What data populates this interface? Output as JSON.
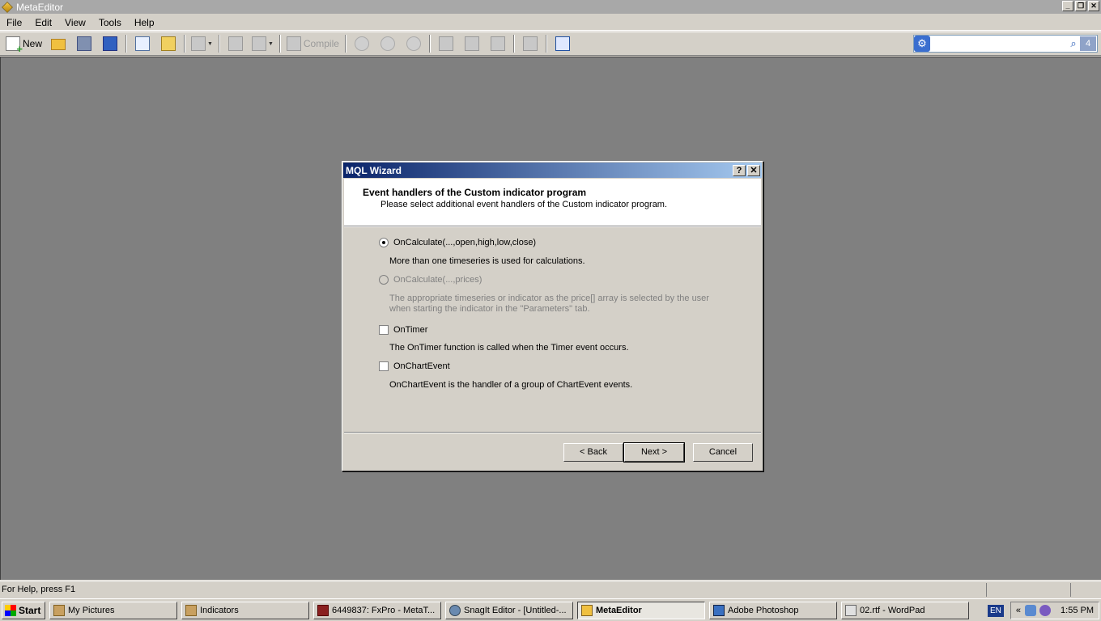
{
  "window": {
    "title": "MetaEditor"
  },
  "menu": [
    "File",
    "Edit",
    "View",
    "Tools",
    "Help"
  ],
  "toolbar": {
    "new_label": "New",
    "compile_label": "Compile"
  },
  "search": {
    "value": "",
    "badge": "4"
  },
  "dialog": {
    "title": "MQL Wizard",
    "help_btn": "?",
    "close_btn": "✕",
    "heading": "Event handlers of the Custom indicator program",
    "subheading": "Please select additional event handlers of the Custom indicator program.",
    "options": [
      {
        "label": "OnCalculate(...,open,high,low,close)",
        "desc": "More than one timeseries is used for calculations."
      },
      {
        "label": "OnCalculate(...,prices)",
        "desc": "The appropriate timeseries or indicator as the price[] array is selected by the user when starting the indicator in the \"Parameters\" tab."
      },
      {
        "label": "OnTimer",
        "desc": "The OnTimer function is called when the Timer event occurs."
      },
      {
        "label": "OnChartEvent",
        "desc": "OnChartEvent is the handler of a group of ChartEvent events."
      }
    ],
    "buttons": {
      "back": "< Back",
      "next": "Next >",
      "cancel": "Cancel"
    }
  },
  "status": {
    "text": "For Help, press F1"
  },
  "taskbar": {
    "start": "Start",
    "tasks": [
      "My Pictures",
      "Indicators",
      "6449837: FxPro - MetaT...",
      "SnagIt Editor - [Untitled-...",
      "MetaEditor",
      "Adobe Photoshop",
      "02.rtf - WordPad"
    ],
    "lang": "EN",
    "chevron": "«",
    "clock": "1:55 PM"
  }
}
